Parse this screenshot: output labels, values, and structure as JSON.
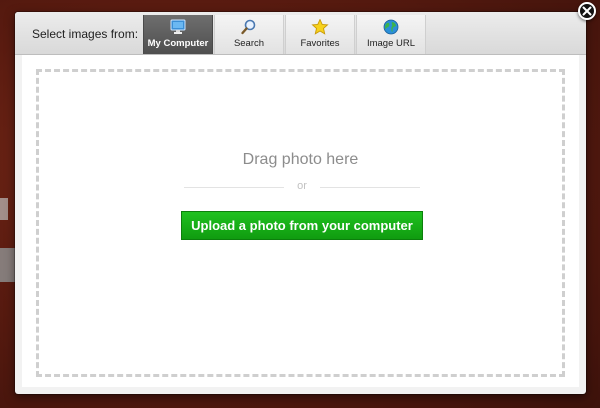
{
  "toolbar": {
    "label": "Select images from:",
    "tabs": [
      {
        "label": "My Computer",
        "icon": "monitor-icon",
        "active": true
      },
      {
        "label": "Search",
        "icon": "magnifier-icon",
        "active": false
      },
      {
        "label": "Favorites",
        "icon": "star-icon",
        "active": false
      },
      {
        "label": "Image URL",
        "icon": "globe-icon",
        "active": false
      }
    ]
  },
  "dropzone": {
    "drag_text": "Drag photo here",
    "or_text": "or",
    "upload_label": "Upload a photo from your computer"
  },
  "close": {
    "icon": "close-icon"
  },
  "colors": {
    "upload_button": "#14aa14",
    "active_tab": "#5a5a5a",
    "backdrop": "#5b1d12"
  }
}
